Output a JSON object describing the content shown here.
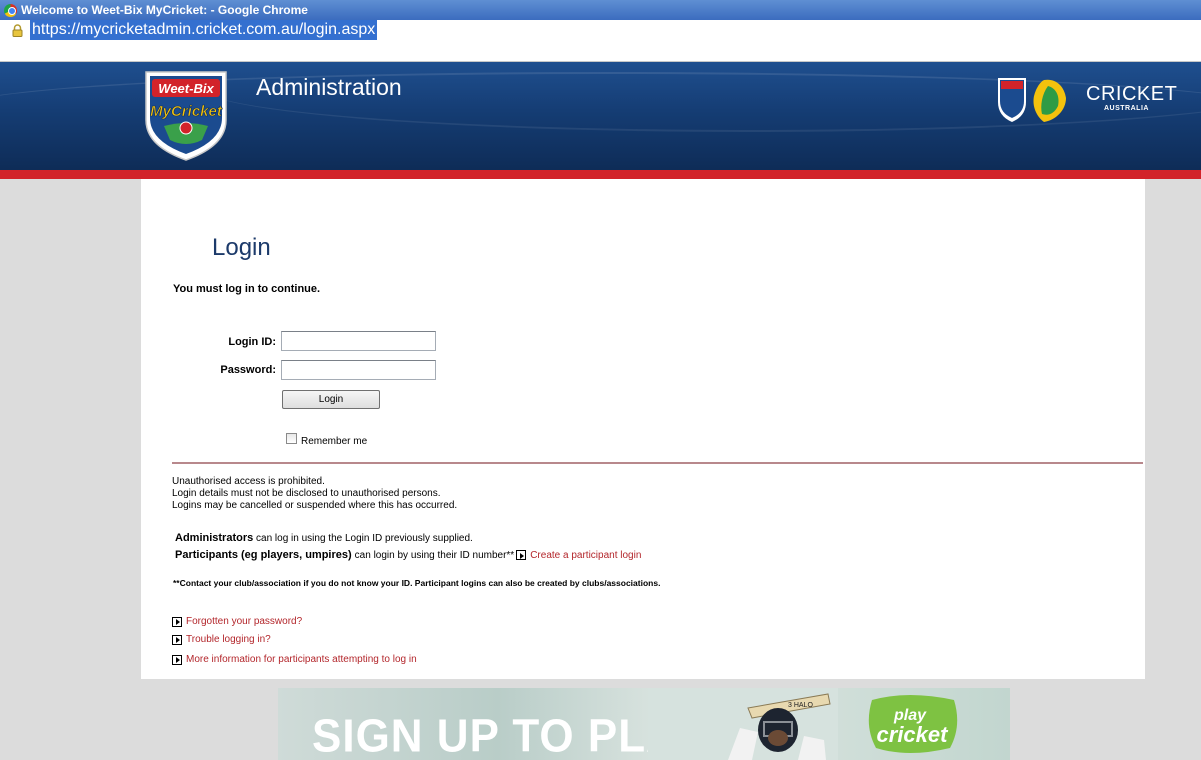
{
  "window": {
    "title": "Welcome to Weet-Bix MyCricket: - Google Chrome"
  },
  "address_bar": {
    "url": "https://mycricketadmin.cricket.com.au/login.aspx"
  },
  "header": {
    "logo_top": "Weet-Bix",
    "logo_bottom": "MyCricket",
    "title": "Administration",
    "partner_name": "CRICKET",
    "partner_sub": "AUSTRALIA"
  },
  "login": {
    "heading": "Login",
    "must_login": "You must log in to continue.",
    "login_id_label": "Login ID:",
    "login_id_value": "",
    "password_label": "Password:",
    "password_value": "",
    "button_label": "Login",
    "remember_label": "Remember me"
  },
  "notices": {
    "line1": "Unauthorised access is prohibited.",
    "line2": "Login details must not be disclosed to unauthorised persons.",
    "line3": "Logins may be cancelled or suspended where this has occurred.",
    "admins_bold": "Administrators",
    "admins_text": " can log in using the Login ID previously supplied.",
    "participants_bold": "Participants (eg players, umpires)",
    "participants_text": "can login by using their ID number**",
    "create_participant_link": "Create a participant login",
    "contact": "**Contact your club/association if you do not know your ID. Participant logins can also be created by clubs/associations."
  },
  "help_links": [
    "Forgotten your password?",
    "Trouble logging in?",
    "More information for participants attempting to log in"
  ],
  "promo": {
    "headline": "SIGN UP TO PLAY",
    "brand_top": "play",
    "brand_bottom": "cricket"
  },
  "colors": {
    "banner": "#153d74",
    "stripe": "#d2232a",
    "heading": "#1c3a6a",
    "link": "#b3262b"
  }
}
